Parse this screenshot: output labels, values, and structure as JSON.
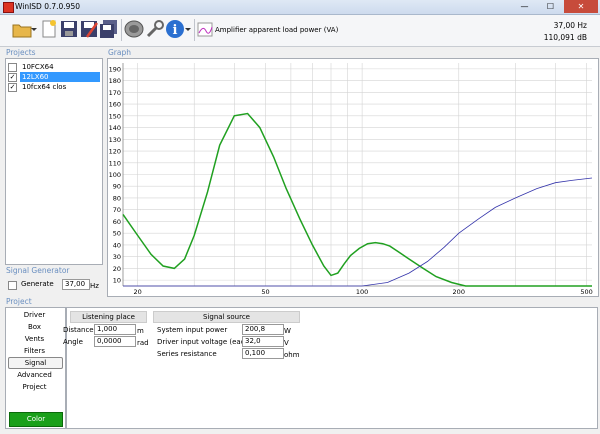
{
  "window": {
    "title": "WinISD 0.7.0.950",
    "minimize": "—",
    "maximize": "☐",
    "close": "✕"
  },
  "toolbar": {
    "response_label": "Amplifier apparent load power (VA)",
    "readout_freq": "37,00 Hz",
    "readout_db": "110,091 dB",
    "icons": [
      "open-folder-icon",
      "new-document-icon",
      "save-icon",
      "save-as-icon",
      "save-all-icon",
      "driver-icon",
      "tools-icon",
      "info-icon",
      "dropdown-arrow-icon",
      "graph-icon"
    ]
  },
  "projects": {
    "label": "Projects",
    "items": [
      {
        "name": "10FCX64",
        "checked": false,
        "selected": false
      },
      {
        "name": "12LX60",
        "checked": true,
        "selected": true
      },
      {
        "name": "10fcx64 clos",
        "checked": true,
        "selected": false
      }
    ]
  },
  "graph": {
    "label": "Graph",
    "chart_data": {
      "type": "line",
      "xscale": "log",
      "xlim": [
        18,
        520
      ],
      "ylim": [
        5,
        195
      ],
      "x_ticks": [
        20,
        50,
        100,
        200,
        500
      ],
      "y_ticks": [
        10,
        20,
        30,
        40,
        50,
        60,
        70,
        80,
        90,
        100,
        110,
        120,
        130,
        140,
        150,
        160,
        170,
        180,
        190
      ],
      "grid": true,
      "series": [
        {
          "color": "#20a020",
          "x": [
            18,
            20,
            22,
            24,
            26,
            28,
            30,
            33,
            36,
            40,
            44,
            48,
            53,
            58,
            64,
            70,
            76,
            80,
            84,
            88,
            92,
            98,
            104,
            110,
            116,
            122,
            130,
            140,
            155,
            170,
            190,
            210,
            240,
            280,
            330,
            400,
            520
          ],
          "y": [
            66,
            48,
            32,
            22,
            20,
            28,
            48,
            85,
            125,
            150,
            152,
            140,
            115,
            88,
            62,
            40,
            22,
            14,
            16,
            24,
            31,
            37,
            41,
            42,
            41,
            39,
            34,
            28,
            20,
            13,
            8,
            5,
            3,
            2,
            2,
            2,
            2
          ]
        },
        {
          "color": "#3333aa",
          "x": [
            18,
            60,
            80,
            100,
            120,
            140,
            160,
            180,
            200,
            230,
            260,
            300,
            350,
            400,
            450,
            520
          ],
          "y": [
            0,
            0,
            1,
            3,
            8,
            16,
            26,
            38,
            50,
            62,
            72,
            80,
            88,
            93,
            95,
            97
          ]
        }
      ]
    }
  },
  "signal_generator": {
    "label": "Signal Generator",
    "generate_label": "Generate",
    "generate_checked": false,
    "freq_value": "37,00",
    "unit": "Hz"
  },
  "project_panel": {
    "label": "Project",
    "nav": [
      "Driver",
      "Box",
      "Vents",
      "Filters",
      "Signal",
      "Advanced",
      "Project"
    ],
    "selected_nav": "Signal",
    "color_button": "Color"
  },
  "listening_place": {
    "header": "Listening place",
    "distance_label": "Distance",
    "distance_value": "1,000",
    "distance_unit": "m",
    "angle_label": "Angle",
    "angle_value": "0,0000",
    "angle_unit": "rad"
  },
  "signal_source": {
    "header": "Signal source",
    "power_label": "System input power",
    "power_value": "200,8",
    "power_unit": "W",
    "voltage_label": "Driver input voltage (each)",
    "voltage_value": "32,0",
    "voltage_unit": "V",
    "resistance_label": "Series resistance",
    "resistance_value": "0,100",
    "resistance_unit": "ohm"
  }
}
